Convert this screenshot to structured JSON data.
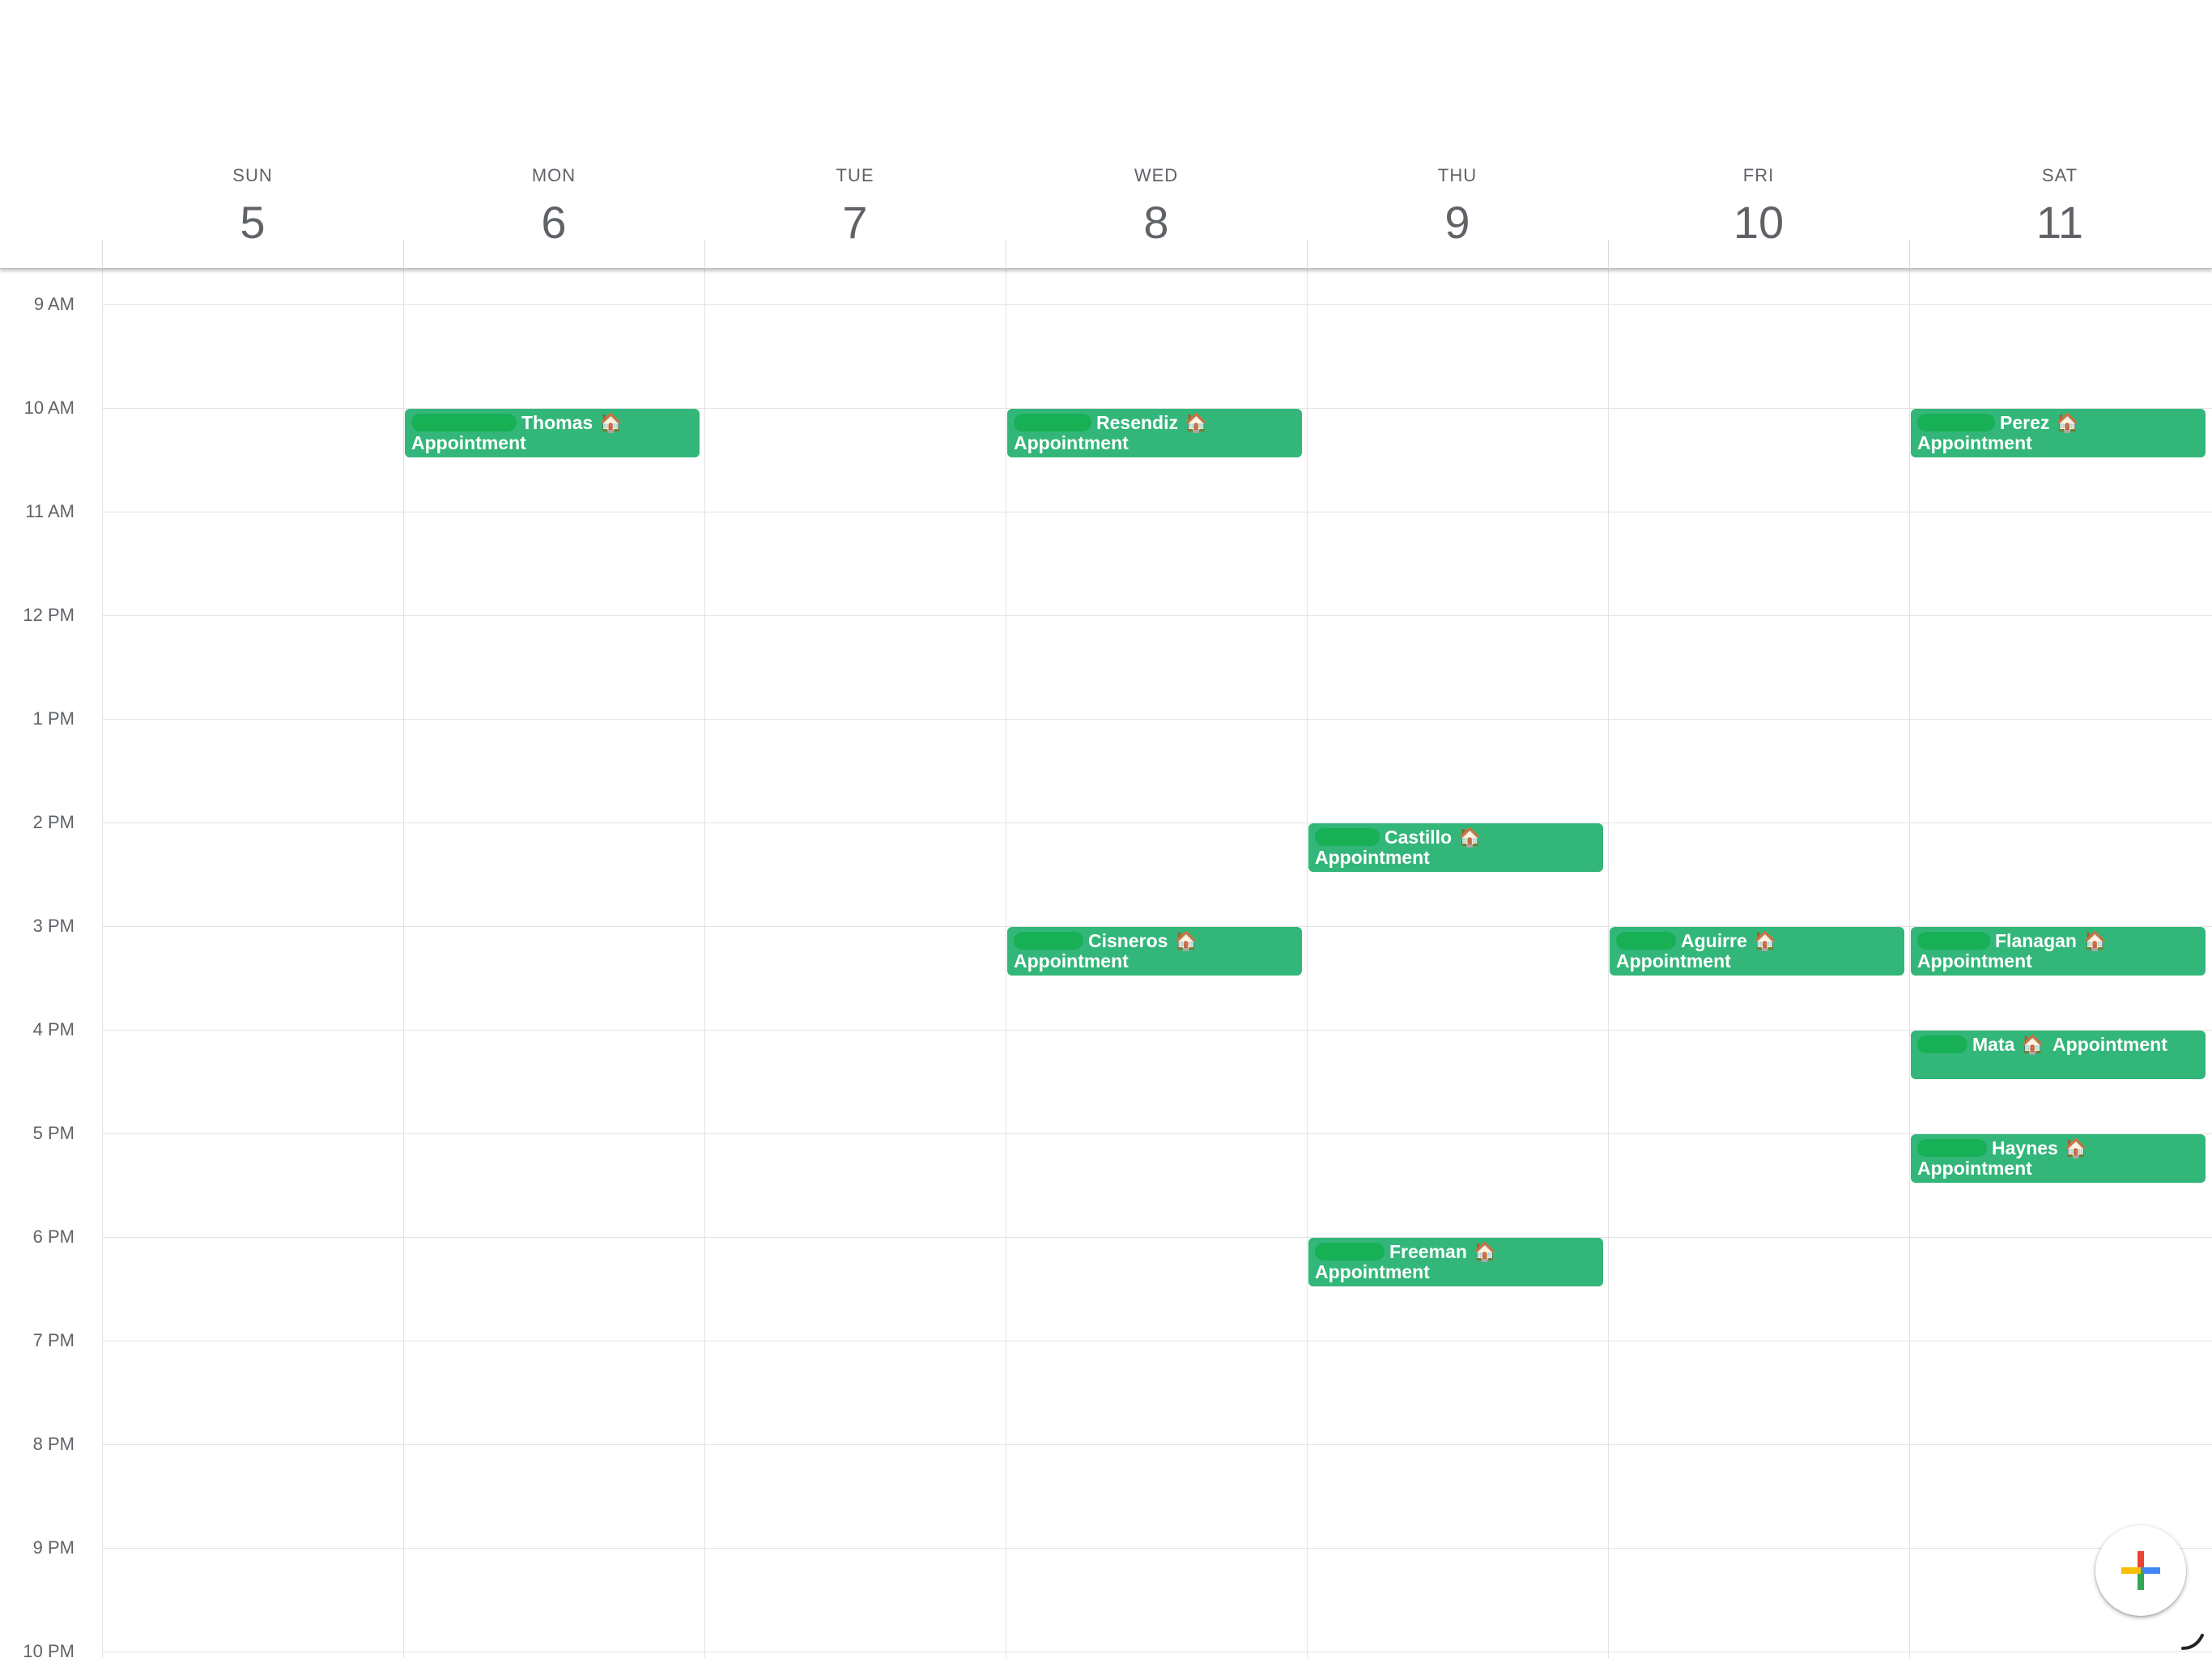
{
  "days": [
    {
      "dow": "SUN",
      "num": "5"
    },
    {
      "dow": "MON",
      "num": "6"
    },
    {
      "dow": "TUE",
      "num": "7"
    },
    {
      "dow": "WED",
      "num": "8"
    },
    {
      "dow": "THU",
      "num": "9"
    },
    {
      "dow": "FRI",
      "num": "10"
    },
    {
      "dow": "SAT",
      "num": "11"
    }
  ],
  "hours": [
    "9 AM",
    "10 AM",
    "11 AM",
    "12 PM",
    "1 PM",
    "2 PM",
    "3 PM",
    "4 PM",
    "5 PM",
    "6 PM",
    "7 PM",
    "8 PM",
    "9 PM",
    "10 PM"
  ],
  "events": [
    {
      "name": "Thomas",
      "label": "Appointment",
      "icon": "🏠",
      "day": "MON",
      "start": "10 AM"
    },
    {
      "name": "Resendiz",
      "label": "Appointment",
      "icon": "🏠",
      "day": "WED",
      "start": "10 AM"
    },
    {
      "name": "Perez",
      "label": "Appointment",
      "icon": "🏠",
      "day": "SAT",
      "start": "10 AM"
    },
    {
      "name": "Castillo",
      "label": "Appointment",
      "icon": "🏠",
      "day": "THU",
      "start": "2 PM"
    },
    {
      "name": "Cisneros",
      "label": "Appointment",
      "icon": "🏠",
      "day": "WED",
      "start": "3 PM"
    },
    {
      "name": "Aguirre",
      "label": "Appointment",
      "icon": "🏠",
      "day": "FRI",
      "start": "3 PM"
    },
    {
      "name": "Flanagan",
      "label": "Appointment",
      "icon": "🏠",
      "day": "SAT",
      "start": "3 PM"
    },
    {
      "name": "Mata",
      "label": "Appointment",
      "icon": "🏠",
      "day": "SAT",
      "start": "4 PM"
    },
    {
      "name": "Haynes",
      "label": "Appointment",
      "icon": "🏠",
      "day": "SAT",
      "start": "5 PM"
    },
    {
      "name": "Freeman",
      "label": "Appointment",
      "icon": "🏠",
      "day": "THU",
      "start": "6 PM"
    }
  ],
  "fab": {
    "icon": "plus-icon"
  },
  "colors": {
    "event": "#33b679",
    "fab_plus": [
      "#ea4335",
      "#4285f4",
      "#34a853",
      "#fbbc04"
    ]
  }
}
